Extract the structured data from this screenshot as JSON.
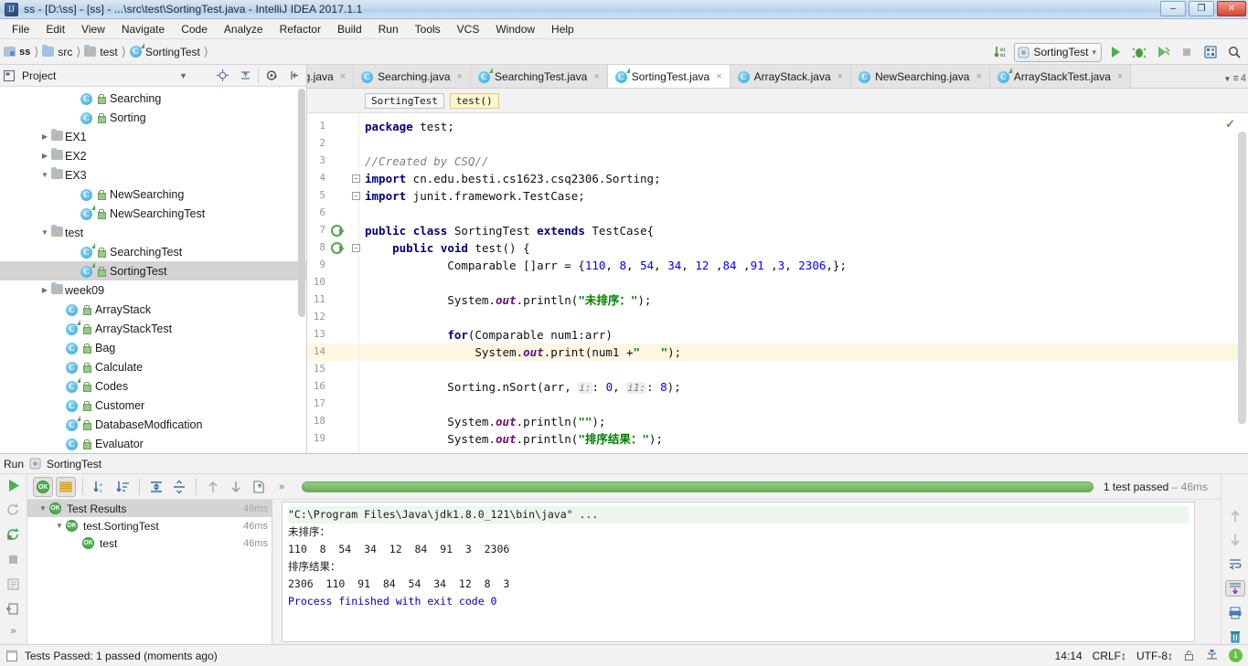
{
  "window": {
    "title": "ss - [D:\\ss] - [ss] - ...\\src\\test\\SortingTest.java - IntelliJ IDEA 2017.1.1",
    "app_icon": "intellij-idea-icon",
    "minimize": "–",
    "maximize": "❐",
    "close": "✕"
  },
  "menu": {
    "items": [
      "File",
      "Edit",
      "View",
      "Navigate",
      "Code",
      "Analyze",
      "Refactor",
      "Build",
      "Run",
      "Tools",
      "VCS",
      "Window",
      "Help"
    ]
  },
  "navbar": {
    "breadcrumbs": [
      {
        "label": "ss",
        "icon": "module-icon"
      },
      {
        "label": "src",
        "icon": "folder-icon"
      },
      {
        "label": "test",
        "icon": "folder-icon"
      },
      {
        "label": "SortingTest",
        "icon": "class-icon"
      }
    ],
    "sort_icon": "sort-numeric-icon",
    "run_config": "SortingTest",
    "run_config_icon": "run-config-icon",
    "dropdown_caret": "▾",
    "actions": [
      "run-icon",
      "debug-icon",
      "run-coverage-icon",
      "stop-icon",
      "build-project-icon",
      "search-everywhere-icon"
    ]
  },
  "project_panel": {
    "title": "Project",
    "title_icon": "project-view-icon",
    "header_icons": [
      "collapse-dropdown-icon",
      "locate-icon",
      "expand-collapse-icon",
      "settings-gear-icon",
      "hide-icon"
    ],
    "tree": [
      {
        "label": "Searching",
        "indent": 4,
        "arrow": "none",
        "icon": "class-icon",
        "test": false,
        "selected": false
      },
      {
        "label": "Sorting",
        "indent": 4,
        "arrow": "none",
        "icon": "class-icon",
        "test": false,
        "selected": false
      },
      {
        "label": "EX1",
        "indent": 2,
        "arrow": "collapsed",
        "icon": "folder-icon",
        "test": false,
        "selected": false
      },
      {
        "label": "EX2",
        "indent": 2,
        "arrow": "collapsed",
        "icon": "folder-icon",
        "test": false,
        "selected": false
      },
      {
        "label": "EX3",
        "indent": 2,
        "arrow": "expanded",
        "icon": "folder-icon",
        "test": false,
        "selected": false
      },
      {
        "label": "NewSearching",
        "indent": 4,
        "arrow": "none",
        "icon": "class-icon",
        "test": false,
        "selected": false
      },
      {
        "label": "NewSearchingTest",
        "indent": 4,
        "arrow": "none",
        "icon": "class-icon",
        "test": true,
        "selected": false
      },
      {
        "label": "test",
        "indent": 2,
        "arrow": "expanded",
        "icon": "folder-icon",
        "test": false,
        "selected": false
      },
      {
        "label": "SearchingTest",
        "indent": 4,
        "arrow": "none",
        "icon": "class-icon",
        "test": true,
        "selected": false
      },
      {
        "label": "SortingTest",
        "indent": 4,
        "arrow": "none",
        "icon": "class-icon",
        "test": true,
        "selected": true
      },
      {
        "label": "week09",
        "indent": 2,
        "arrow": "collapsed",
        "icon": "folder-icon",
        "test": false,
        "selected": false
      },
      {
        "label": "ArrayStack",
        "indent": 3,
        "arrow": "none",
        "icon": "class-icon",
        "test": false,
        "selected": false
      },
      {
        "label": "ArrayStackTest",
        "indent": 3,
        "arrow": "none",
        "icon": "class-icon",
        "test": true,
        "selected": false
      },
      {
        "label": "Bag",
        "indent": 3,
        "arrow": "none",
        "icon": "class-icon",
        "test": false,
        "selected": false
      },
      {
        "label": "Calculate",
        "indent": 3,
        "arrow": "none",
        "icon": "class-icon",
        "test": false,
        "selected": false
      },
      {
        "label": "Codes",
        "indent": 3,
        "arrow": "none",
        "icon": "class-icon",
        "test": true,
        "selected": false
      },
      {
        "label": "Customer",
        "indent": 3,
        "arrow": "none",
        "icon": "class-icon",
        "test": false,
        "selected": false
      },
      {
        "label": "DatabaseModfication",
        "indent": 3,
        "arrow": "none",
        "icon": "class-icon",
        "test": true,
        "selected": false
      },
      {
        "label": "Evaluator",
        "indent": 3,
        "arrow": "none",
        "icon": "class-icon",
        "test": false,
        "selected": false
      }
    ]
  },
  "editor": {
    "tabs": [
      {
        "label": "ng.java",
        "icon": "class-icon",
        "test": false,
        "active": false,
        "clipped": true
      },
      {
        "label": "Searching.java",
        "icon": "class-icon",
        "test": false,
        "active": false
      },
      {
        "label": "SearchingTest.java",
        "icon": "class-icon",
        "test": true,
        "active": false
      },
      {
        "label": "SortingTest.java",
        "icon": "class-icon",
        "test": true,
        "active": true
      },
      {
        "label": "ArrayStack.java",
        "icon": "class-icon",
        "test": false,
        "active": false
      },
      {
        "label": "NewSearching.java",
        "icon": "class-icon",
        "test": false,
        "active": false
      },
      {
        "label": "ArrayStackTest.java",
        "icon": "class-icon",
        "test": true,
        "active": false
      }
    ],
    "tab_close_glyph": "×",
    "tabs_overflow_label": "4",
    "tabs_overflow_icon": "tab-list-icon",
    "breadcrumbs": [
      {
        "label": "SortingTest",
        "highlighted": false
      },
      {
        "label": "test()",
        "highlighted": true
      }
    ],
    "inspection_status_icon": "inspections-ok-icon",
    "highlighted_line": 14,
    "first_line": 1,
    "lines": [
      {
        "n": 1,
        "text": "package test;"
      },
      {
        "n": 2,
        "text": ""
      },
      {
        "n": 3,
        "text": "//Created by CSQ//"
      },
      {
        "n": 4,
        "text": "import cn.edu.besti.cs1623.csq2306.Sorting;"
      },
      {
        "n": 5,
        "text": "import junit.framework.TestCase;"
      },
      {
        "n": 6,
        "text": ""
      },
      {
        "n": 7,
        "text": "public class SortingTest extends TestCase{"
      },
      {
        "n": 8,
        "text": "    public void test() {"
      },
      {
        "n": 9,
        "text": "            Comparable []arr = {110, 8, 54, 34, 12 ,84 ,91 ,3, 2306,};"
      },
      {
        "n": 10,
        "text": ""
      },
      {
        "n": 11,
        "text": "            System.out.println(\"未排序：\");"
      },
      {
        "n": 12,
        "text": ""
      },
      {
        "n": 13,
        "text": "            for(Comparable num1:arr)"
      },
      {
        "n": 14,
        "text": "                System.out.print(num1 +\"   \");"
      },
      {
        "n": 15,
        "text": ""
      },
      {
        "n": 16,
        "text": "            Sorting.nSort(arr, i: 0, i1: 8);"
      },
      {
        "n": 17,
        "text": ""
      },
      {
        "n": 18,
        "text": "            System.out.println(\"\");"
      },
      {
        "n": 19,
        "text": "            System.out.println(\"排序结果：\");"
      }
    ],
    "gutter_run_marks": [
      7,
      8
    ]
  },
  "run_window": {
    "title": "Run",
    "config_name": "SortingTest",
    "config_icon": "run-config-icon",
    "left_actions": [
      "rerun-icon",
      "rerun-failed-icon",
      "toggle-auto-test-icon",
      "stop-icon",
      "dump-threads-icon",
      "restore-layout-icon",
      "more-icon",
      "pin-icon"
    ],
    "right_actions": [
      "scroll-up-icon",
      "scroll-down-icon",
      "wrap-text-icon",
      "scroll-to-end-icon",
      "print-icon",
      "trash-icon"
    ],
    "toolbar_actions": [
      "show-passed-icon",
      "show-ignored-icon",
      "sort-alphabetically-icon",
      "sort-by-duration-icon",
      "expand-all-icon",
      "collapse-all-icon",
      "prev-failed-icon",
      "next-failed-icon",
      "export-icon",
      "more-actions-icon"
    ],
    "progress_label": "1 test passed",
    "progress_duration": "– 46ms",
    "progress_percent": 100,
    "tests": [
      {
        "label": "Test Results",
        "time": "46ms",
        "indent": 0,
        "arrow": "expanded",
        "selected": true
      },
      {
        "label": "test.SortingTest",
        "time": "46ms",
        "indent": 1,
        "arrow": "expanded",
        "selected": false
      },
      {
        "label": "test",
        "time": "46ms",
        "indent": 2,
        "arrow": "none",
        "selected": false
      }
    ],
    "console": [
      {
        "text": "\"C:\\Program Files\\Java\\jdk1.8.0_121\\bin\\java\" ...",
        "style": "path"
      },
      {
        "text": "未排序：",
        "style": "plain"
      },
      {
        "text": "110  8  54  34  12  84  91  3  2306",
        "style": "plain"
      },
      {
        "text": "排序结果：",
        "style": "plain"
      },
      {
        "text": "2306  110  91  84  54  34  12  8  3",
        "style": "plain"
      },
      {
        "text": "Process finished with exit code 0",
        "style": "process"
      }
    ]
  },
  "statusbar": {
    "icon": "window-icon",
    "message": "Tests Passed: 1 passed (moments ago)",
    "time": "14:14",
    "line_separator": "CRLF↕",
    "encoding": "UTF-8↕",
    "lock_icon": "lock-icon",
    "vcs_icon": "vcs-icon",
    "notification_count": "1"
  },
  "colors": {
    "accent_green": "#4caf50",
    "keyword_blue": "#000080",
    "string_green": "#008000",
    "number_blue": "#0000ff",
    "comment_gray": "#808080",
    "field_purple": "#660e7a",
    "selection_gray": "#d4d4d4",
    "highlight_yellow": "#fcf8e3"
  }
}
